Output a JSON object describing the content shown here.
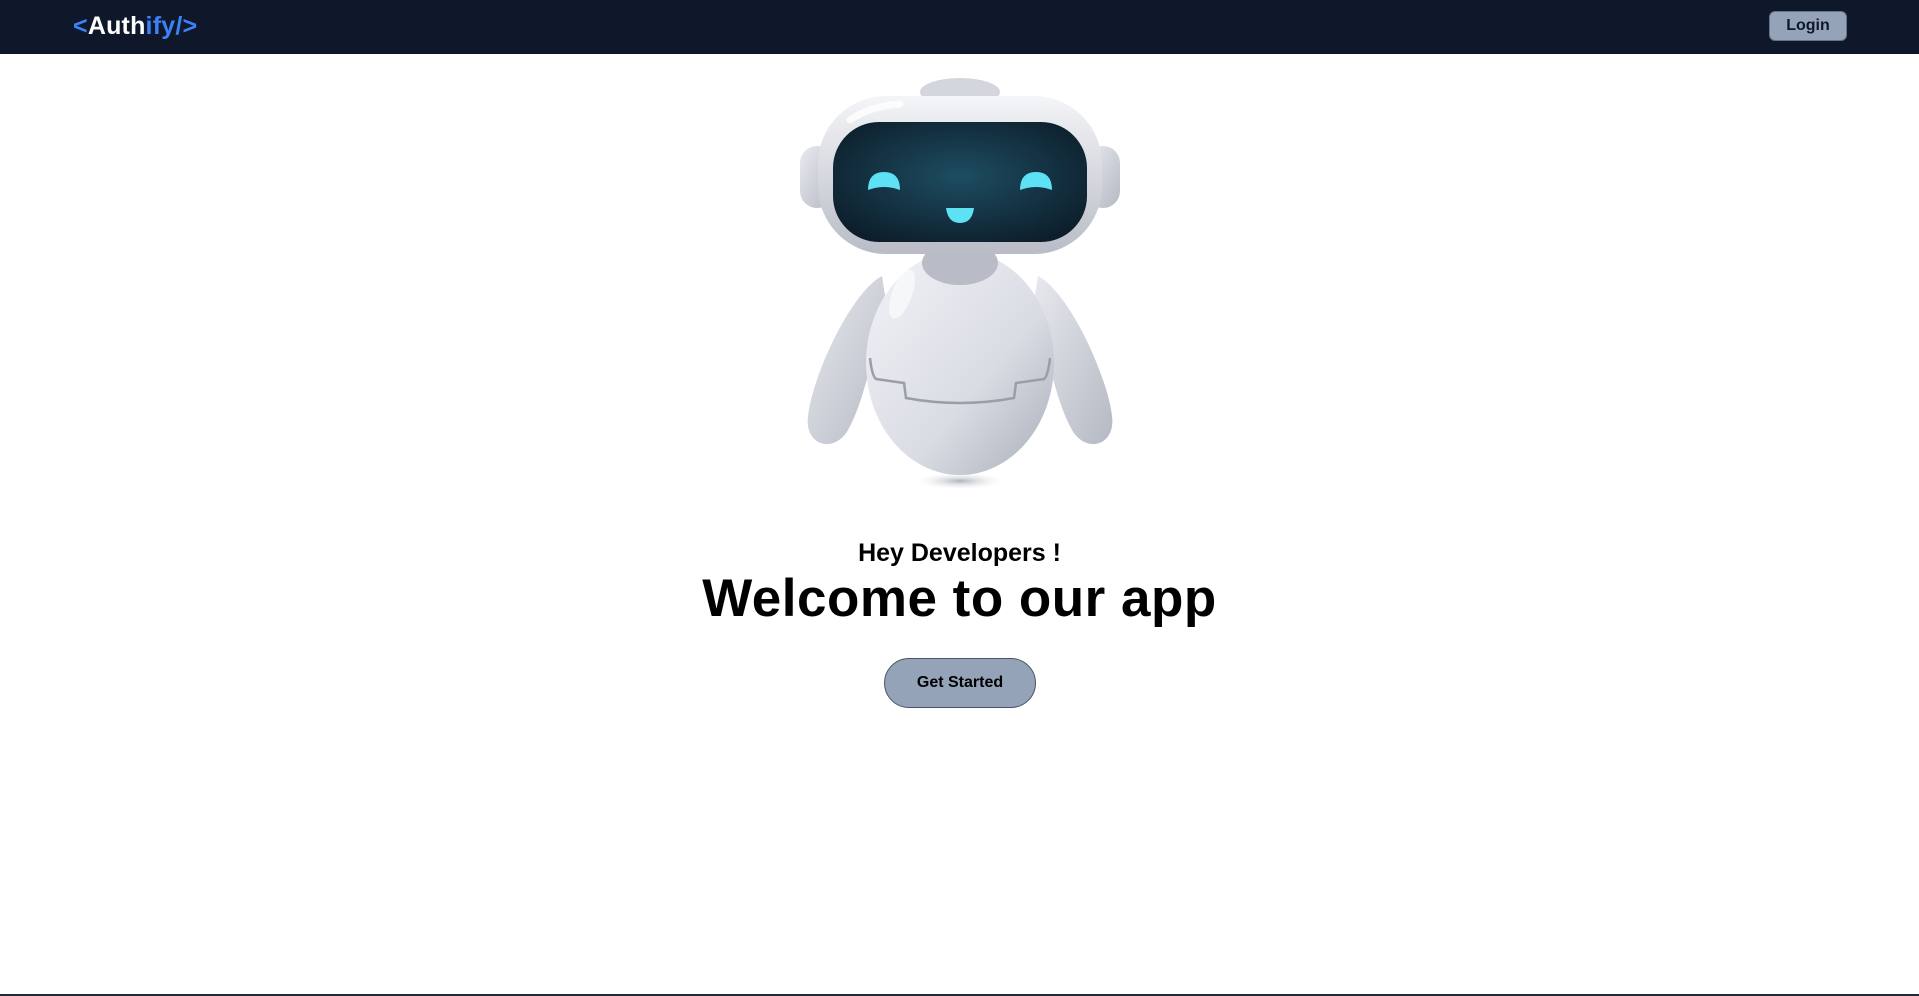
{
  "navbar": {
    "logo": {
      "open": "<",
      "name_main": "Auth",
      "name_accent": "ify",
      "close": "/>"
    },
    "login_label": "Login"
  },
  "hero": {
    "greeting": "Hey Developers !",
    "headline": "Welcome to our app",
    "cta_label": "Get Started"
  },
  "colors": {
    "navbar_bg": "#0f172a",
    "logo_accent": "#3b82f6",
    "button_bg": "#94a3b8",
    "robot_eyes": "#5ee0f5"
  },
  "illustration": "robot-mascot"
}
